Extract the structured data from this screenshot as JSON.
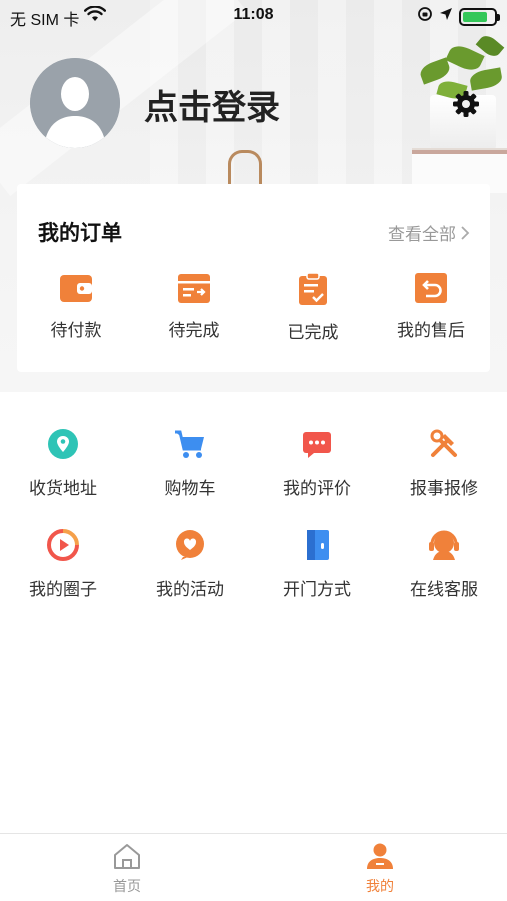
{
  "status_bar": {
    "carrier": "无 SIM 卡",
    "time": "11:08",
    "battery_level": 0.8,
    "battery_color": "#34c759"
  },
  "profile": {
    "login_label": "点击登录",
    "avatar_icon": "user-silhouette-icon",
    "settings_icon": "gear-icon"
  },
  "orders": {
    "title": "我的订单",
    "view_all_label": "查看全部",
    "items": [
      {
        "label": "待付款",
        "icon": "wallet-icon"
      },
      {
        "label": "待完成",
        "icon": "pending-icon"
      },
      {
        "label": "已完成",
        "icon": "clipboard-check-icon"
      },
      {
        "label": "我的售后",
        "icon": "return-icon"
      }
    ]
  },
  "services": [
    {
      "label": "收货地址",
      "icon": "location-pin-icon"
    },
    {
      "label": "购物车",
      "icon": "shopping-cart-icon"
    },
    {
      "label": "我的评价",
      "icon": "comment-icon"
    },
    {
      "label": "报事报修",
      "icon": "repair-tools-icon"
    },
    {
      "label": "我的圈子",
      "icon": "circle-play-icon"
    },
    {
      "label": "我的活动",
      "icon": "activity-heart-icon"
    },
    {
      "label": "开门方式",
      "icon": "door-icon"
    },
    {
      "label": "在线客服",
      "icon": "customer-service-icon"
    }
  ],
  "tabbar": {
    "tabs": [
      {
        "label": "首页",
        "icon": "home-icon",
        "active": false
      },
      {
        "label": "我的",
        "icon": "profile-icon",
        "active": true
      }
    ]
  },
  "colors": {
    "accent_orange": "#f0813a",
    "teal": "#2ec4b6",
    "blue": "#3d8ef0",
    "red": "#f1564b",
    "inactive_tab": "#999999"
  }
}
